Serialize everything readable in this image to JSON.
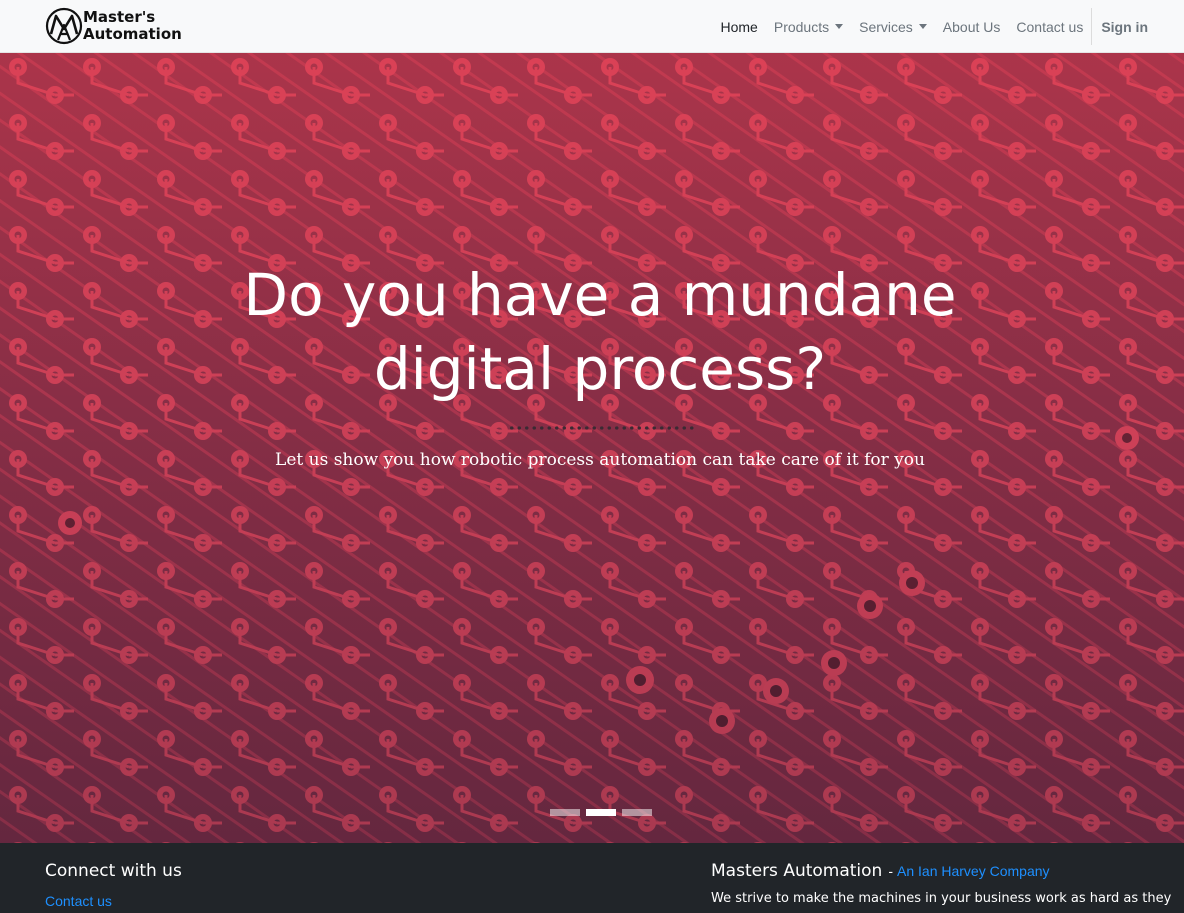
{
  "brand": {
    "name_line1": "Master's",
    "name_line2": "Automation"
  },
  "nav": {
    "home": "Home",
    "products": "Products",
    "services": "Services",
    "about": "About Us",
    "contact": "Contact us",
    "signin": "Sign in"
  },
  "hero": {
    "title_line1": "Do you have a mundane",
    "title_line2": "digital process?",
    "subtitle": "Let us show you how robotic process automation can take care of it for you",
    "slides": [
      {
        "active": false
      },
      {
        "active": true
      },
      {
        "active": false
      }
    ]
  },
  "footer": {
    "connect_heading": "Connect with us",
    "contact_link": "Contact us",
    "company_title": "Masters Automation",
    "separator": "-",
    "company_tagline": "An Ian Harvey Company",
    "description": "We strive to make the machines in your business work as hard as they"
  },
  "colors": {
    "accent_link": "#1e90ff",
    "navbar_bg": "#f8f9fa",
    "footer_bg": "#212529",
    "hero_tint": "#c8384f"
  }
}
